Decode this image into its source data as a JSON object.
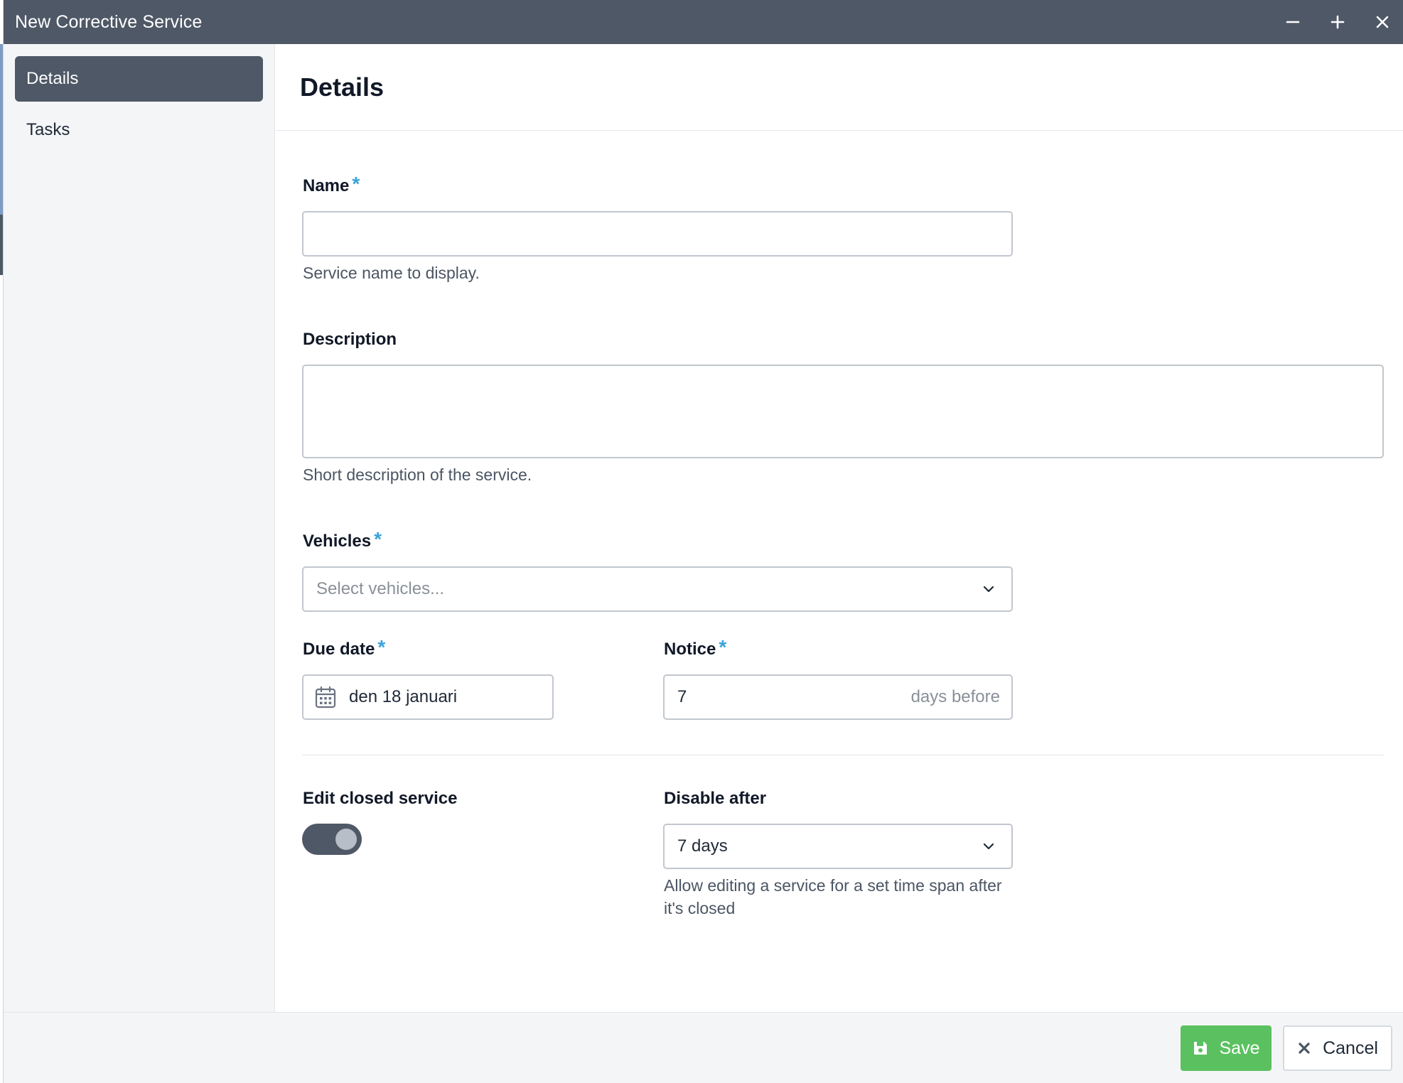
{
  "window": {
    "title": "New Corrective Service"
  },
  "sidebar": {
    "items": [
      {
        "label": "Details",
        "active": true
      },
      {
        "label": "Tasks",
        "active": false
      }
    ]
  },
  "main": {
    "heading": "Details",
    "name": {
      "label": "Name",
      "value": "",
      "help": "Service name to display."
    },
    "description": {
      "label": "Description",
      "value": "",
      "help": "Short description of the service."
    },
    "vehicles": {
      "label": "Vehicles",
      "placeholder": "Select vehicles..."
    },
    "due_date": {
      "label": "Due date",
      "value": "den 18 januari"
    },
    "notice": {
      "label": "Notice",
      "value": "7",
      "suffix": "days before"
    },
    "edit_closed": {
      "label": "Edit closed service",
      "enabled": true
    },
    "disable_after": {
      "label": "Disable after",
      "value": "7 days",
      "help": "Allow editing a service for a set time span after it's closed"
    },
    "required_mark": "*"
  },
  "footer": {
    "save_label": "Save",
    "cancel_label": "Cancel"
  },
  "colors": {
    "titlebar": "#4f5866",
    "accent_required": "#3aa3d9",
    "save": "#5bc160"
  }
}
